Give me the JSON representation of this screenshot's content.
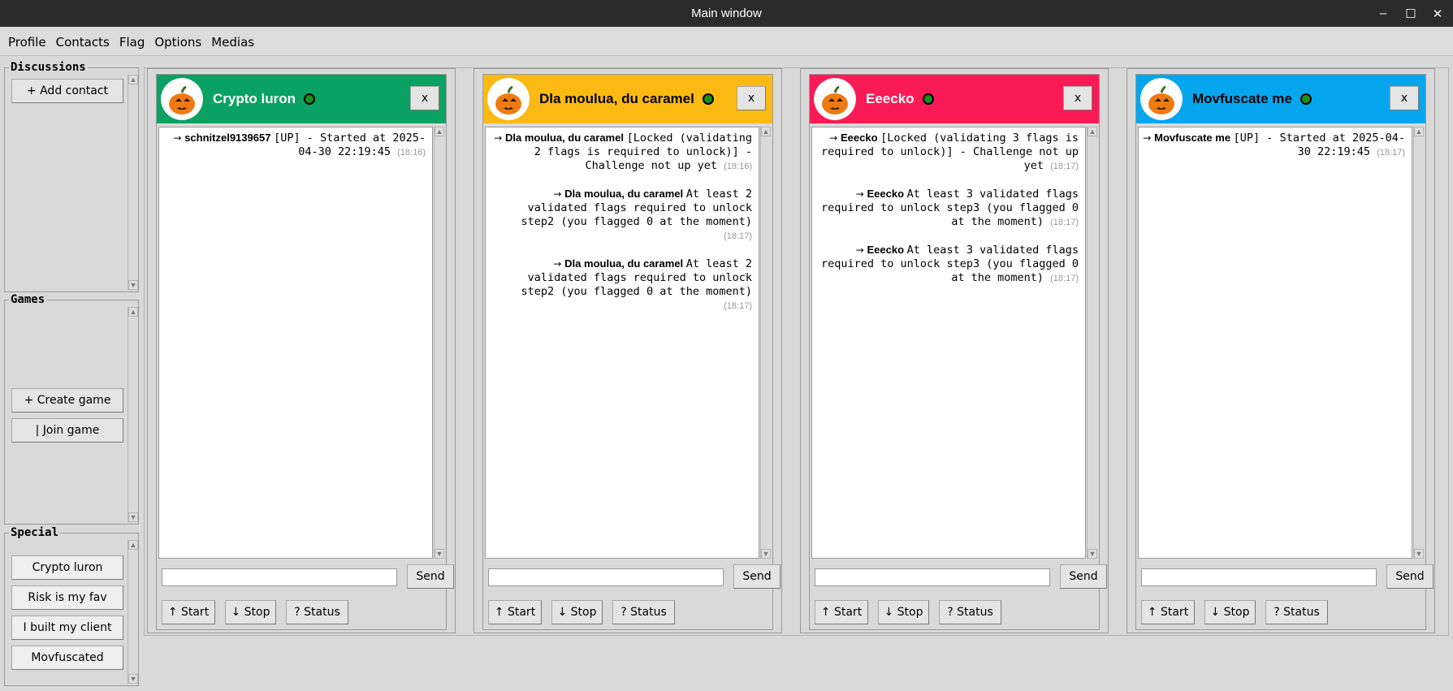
{
  "window": {
    "title": "Main window",
    "minimize": "–",
    "maximize": "☐",
    "close": "✕"
  },
  "menu": [
    "Profile",
    "Contacts",
    "Flag",
    "Options",
    "Medias"
  ],
  "discussions": {
    "title": "Discussions",
    "add_contact": "+ Add contact"
  },
  "games": {
    "title": "Games",
    "create_game": "+ Create game",
    "join_game": "| Join game"
  },
  "special": {
    "title": "Special",
    "items": [
      "Crypto luron",
      "Risk is my fav",
      "I built my client",
      "Movfuscated"
    ]
  },
  "chats": [
    {
      "name": "Crypto luron",
      "header_color": "#0aa262",
      "name_color": "#ffffff",
      "messages": [
        {
          "sender": "schnitzel9139657",
          "text": "[UP] - Started at 2025-04-30 22:19:45",
          "time": "(18:16)"
        }
      ],
      "send": "Send",
      "start": "↑ Start",
      "stop": "↓ Stop",
      "status": "? Status",
      "close": "x"
    },
    {
      "name": "Dla moulua, du caramel",
      "header_color": "#fbb914",
      "name_color": "#000000",
      "messages": [
        {
          "sender": "Dla moulua, du caramel",
          "text": "[Locked (validating 2 flags is required to unlock)] - Challenge not up yet",
          "time": "(18:16)"
        },
        {
          "sender": "Dla moulua, du caramel",
          "text": "At least 2 validated flags required to unlock step2 (you flagged 0 at the moment)",
          "time": "(18:17)"
        },
        {
          "sender": "Dla moulua, du caramel",
          "text": "At least 2 validated flags required to unlock step2 (you flagged 0 at the moment)",
          "time": "(18:17)"
        }
      ],
      "send": "Send",
      "start": "↑ Start",
      "stop": "↓ Stop",
      "status": "? Status",
      "close": "x"
    },
    {
      "name": "Eeecko",
      "header_color": "#fa1a55",
      "name_color": "#ffffff",
      "messages": [
        {
          "sender": "Eeecko",
          "text": "[Locked (validating 3 flags is required to unlock)] - Challenge not up yet",
          "time": "(18:17)"
        },
        {
          "sender": "Eeecko",
          "text": "At least 3 validated flags required to unlock step3 (you flagged 0 at the moment)",
          "time": "(18:17)"
        },
        {
          "sender": "Eeecko",
          "text": "At least 3 validated flags required to unlock step3 (you flagged 0 at the moment)",
          "time": "(18:17)"
        }
      ],
      "send": "Send",
      "start": "↑ Start",
      "stop": "↓ Stop",
      "status": "? Status",
      "close": "x"
    },
    {
      "name": "Movfuscate me",
      "header_color": "#06a6ef",
      "name_color": "#000000",
      "messages": [
        {
          "sender": "Movfuscate me",
          "text": "[UP] - Started at 2025-04-30 22:19:45",
          "time": "(18:17)"
        }
      ],
      "send": "Send",
      "start": "↑ Start",
      "stop": "↓ Stop",
      "status": "? Status",
      "close": "x"
    }
  ]
}
